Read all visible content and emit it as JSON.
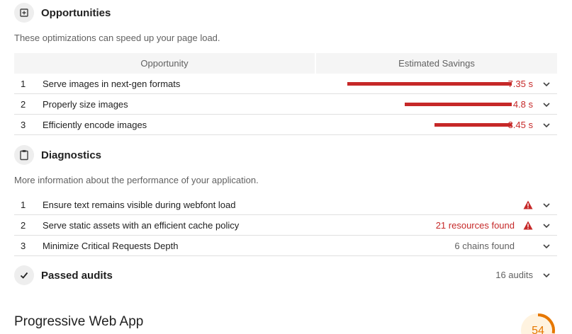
{
  "opportunities": {
    "title": "Opportunities",
    "icon": "opportunity-icon",
    "description": "These optimizations can speed up your page load.",
    "col_opportunity": "Opportunity",
    "col_savings": "Estimated Savings",
    "rows": [
      {
        "num": "1",
        "title": "Serve images in next-gen formats",
        "savings": "7.35 s",
        "bar_fraction": 1.0
      },
      {
        "num": "2",
        "title": "Properly size images",
        "savings": "4.8 s",
        "bar_fraction": 0.653
      },
      {
        "num": "3",
        "title": "Efficiently encode images",
        "savings": "3.45 s",
        "bar_fraction": 0.469
      }
    ]
  },
  "diagnostics": {
    "title": "Diagnostics",
    "icon": "clipboard-icon",
    "description": "More information about the performance of your application.",
    "rows": [
      {
        "num": "1",
        "title": "Ensure text remains visible during webfont load",
        "detail": "",
        "warning": true
      },
      {
        "num": "2",
        "title": "Serve static assets with an efficient cache policy",
        "detail": "21 resources found",
        "warning": true
      },
      {
        "num": "3",
        "title": "Minimize Critical Requests Depth",
        "detail": "6 chains found",
        "warning": false
      }
    ]
  },
  "passed": {
    "title": "Passed audits",
    "icon": "checkmark-icon",
    "count": "16 audits"
  },
  "pwa": {
    "title": "Progressive Web App",
    "score": "54"
  },
  "colors": {
    "fail": "#c62828",
    "average": "#e67700",
    "muted": "#616161"
  }
}
